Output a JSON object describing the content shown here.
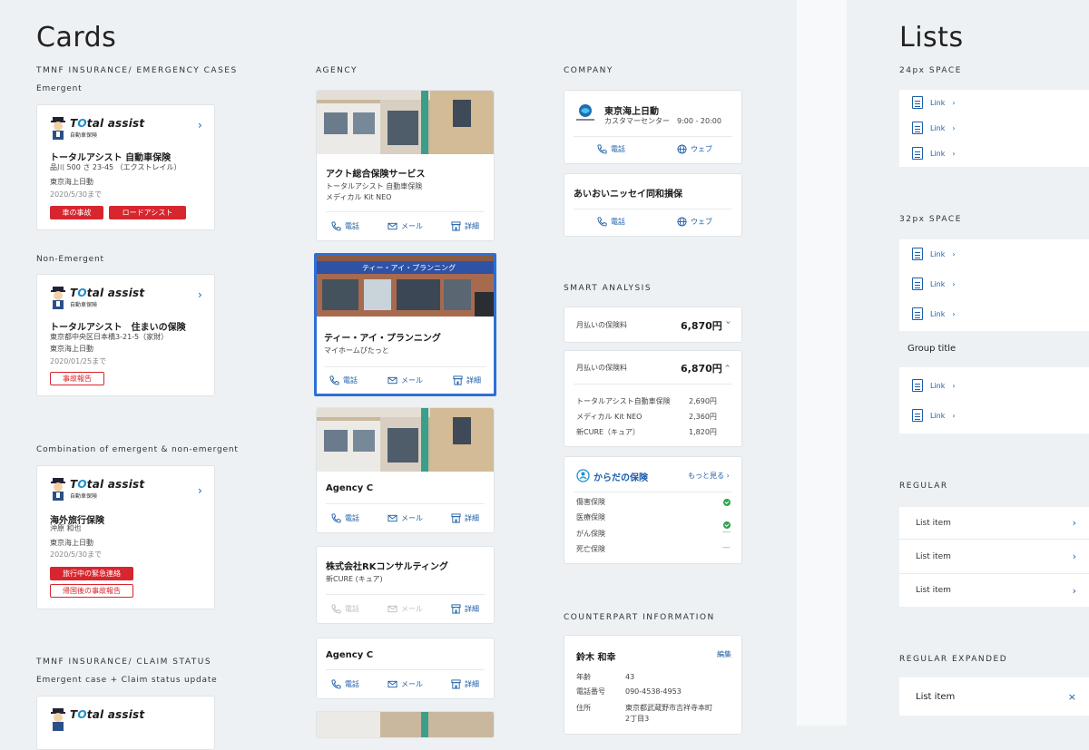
{
  "colors": {
    "accent": "#1d5ea8",
    "danger": "#d7262e",
    "success": "#2ea44f",
    "selected_border": "#2f6fd6"
  },
  "cards": {
    "title": "Cards",
    "tmnf_emergency": {
      "heading": "TMNF INSURANCE/ EMERGENCY CASES",
      "emergent_label": "Emergent",
      "non_emergent_label": "Non-Emergent",
      "combination_label": "Combination of emergent & non-emergent",
      "logo_text_1": "T",
      "logo_text_2": "tal assist",
      "logo_sub": "自動車保険",
      "card1": {
        "title": "トータルアシスト 自動車保険",
        "plate": "品川 500 さ 23-45 （エクストレイル）",
        "company": "東京海上日動",
        "date": "2020/5/30まで",
        "btn1": "車の事故",
        "btn2": "ロードアシスト"
      },
      "card2": {
        "title": "トータルアシスト　住まいの保険",
        "address": "東京都中央区日本橋3-21-5（家財）",
        "company": "東京海上日動",
        "date": "2020/01/25まで",
        "btn1": "事故報告"
      },
      "card3": {
        "title": "海外旅行保険",
        "name": "沖原 和也",
        "company": "東京海上日動",
        "date": "2020/5/30まで",
        "btn1": "旅行中の緊急連絡",
        "btn2": "帰国後の事故報告"
      }
    },
    "tmnf_claim": {
      "heading": "TMNF INSURANCE/ CLAIM STATUS",
      "sub": "Emergent case + Claim status update"
    }
  },
  "agency": {
    "heading": "AGENCY",
    "phone": "電話",
    "mail": "メール",
    "detail": "詳細",
    "items": [
      {
        "name": "アクト総合保険サービス",
        "line1": "トータルアシスト 自動車保険",
        "line2": "メディカル Kit NEO"
      },
      {
        "name": "ティー・アイ・プランニング",
        "line1": "マイホームぴたっと",
        "sign": "ティー・アイ・プランニング"
      },
      {
        "name": "Agency C"
      },
      {
        "name": "株式会社RKコンサルティング",
        "line1": "新CURE (キュア)"
      },
      {
        "name": "Agency C"
      }
    ]
  },
  "company": {
    "heading": "COMPANY",
    "c1": {
      "name": "東京海上日動",
      "desc": "カスタマーセンター　9:00 - 20:00"
    },
    "c2": {
      "name": "あいおいニッセイ同和損保"
    },
    "phone": "電話",
    "web": "ウェブ"
  },
  "smart": {
    "heading": "SMART ANALYSIS",
    "label": "月払いの保険料",
    "amount": "6,870円",
    "breakdown": [
      {
        "name": "トータルアシスト自動車保険",
        "value": "2,690円"
      },
      {
        "name": "メディカル Kit NEO",
        "value": "2,360円"
      },
      {
        "name": "新CURE（キュア）",
        "value": "1,820円"
      }
    ],
    "body_title": "からだの保険",
    "more": "もっと見る",
    "body_items": [
      {
        "name": "傷害保険",
        "status": "check"
      },
      {
        "name": "医療保険",
        "status": "check"
      },
      {
        "name": "がん保険",
        "status": "—"
      },
      {
        "name": "死亡保険",
        "status": "—"
      }
    ]
  },
  "counterpart": {
    "heading": "COUNTERPART INFORMATION",
    "name": "鈴木 和幸",
    "edit": "編集",
    "age_label": "年齢",
    "age": "43",
    "tel_label": "電話番号",
    "tel": "090-4538-4953",
    "addr_label": "住所",
    "addr1": "東京都武蔵野市吉祥寺本町",
    "addr2": "2丁目3"
  },
  "lists": {
    "title": "Lists",
    "space24": "24px SPACE",
    "space32": "32px SPACE",
    "group_title": "Group title",
    "regular": "REGULAR",
    "regular_expanded": "REGULAR EXPANDED",
    "link": "Link",
    "list_item": "List item"
  }
}
